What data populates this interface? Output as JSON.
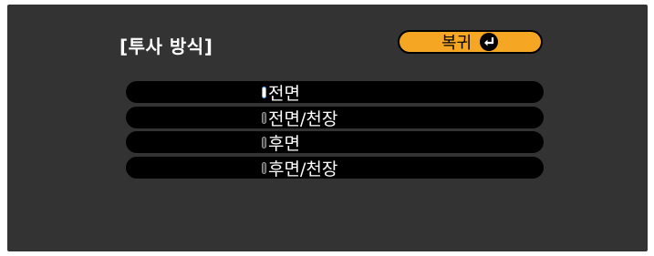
{
  "dialog": {
    "title": "[투사 방식]",
    "return_button": {
      "label": "복귀",
      "icon": "enter-icon"
    }
  },
  "options": [
    {
      "label": "전면",
      "selected": true
    },
    {
      "label": "전면/천장",
      "selected": false
    },
    {
      "label": "후면",
      "selected": false
    },
    {
      "label": "후면/천장",
      "selected": false
    }
  ],
  "colors": {
    "panel": "#333333",
    "button": "#f5a623",
    "row": "#000000",
    "text": "#ffffff",
    "selected_radio_outline": "#4da3ff"
  }
}
